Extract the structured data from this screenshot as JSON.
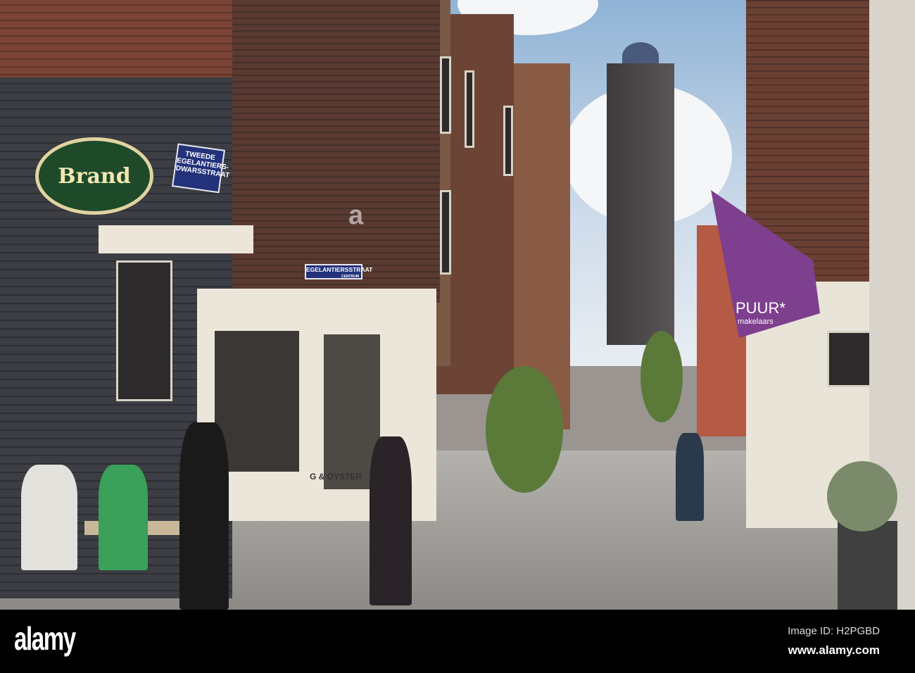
{
  "photo": {
    "signs": {
      "brand": "Brand",
      "street_sign_1": "TWEEDE EGELANTIERS-DWARSSTRAAT",
      "street_sign_2": "EGELANTIERSSTRAAT",
      "street_sign_2_sub": "CENTRUM",
      "shop_text": "G & OYSTER",
      "flag_title": "PUUR*",
      "flag_sub": "makelaars"
    },
    "watermark": "a"
  },
  "footer": {
    "logo": "alamy",
    "image_id": "Image ID: H2PGBD",
    "url": "www.alamy.com"
  },
  "colors": {
    "flag": "#7d3f8e",
    "street_sign": "#23327a"
  }
}
